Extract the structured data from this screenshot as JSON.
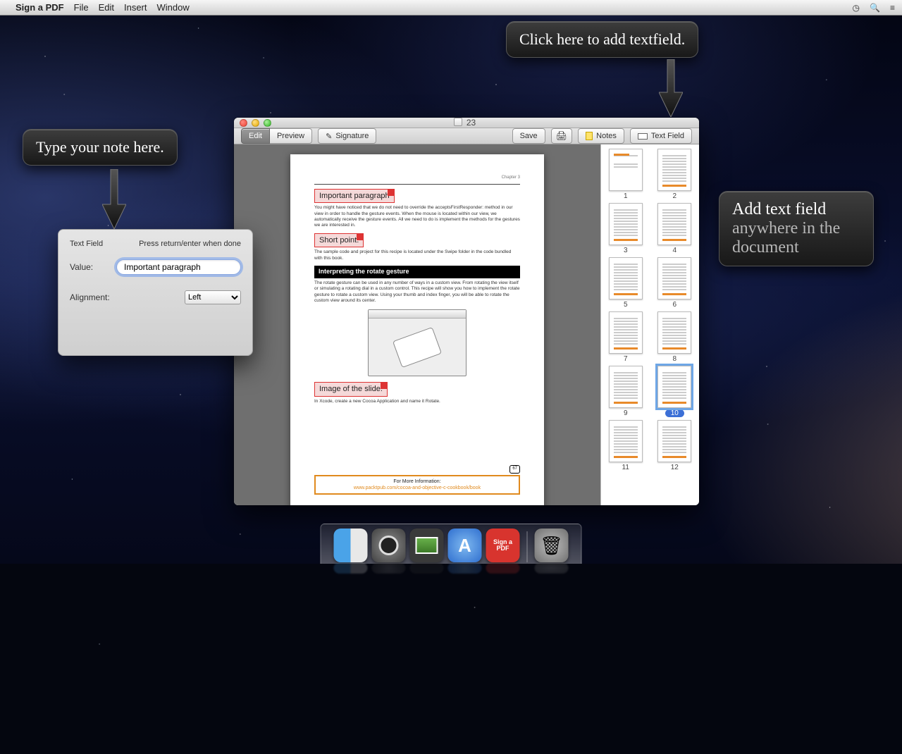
{
  "menubar": {
    "app_name": "Sign a PDF",
    "items": [
      "File",
      "Edit",
      "Insert",
      "Window"
    ]
  },
  "callouts": {
    "type_note": "Type your note here.",
    "click_add": "Click here to add textfield.",
    "anywhere_line1": "Add text field",
    "anywhere_line2": "anywhere in the document"
  },
  "popover": {
    "title": "Text Field",
    "hint": "Press return/enter when done",
    "value_label": "Value:",
    "value": "Important paragraph",
    "align_label": "Alignment:",
    "align_value": "Left"
  },
  "window": {
    "title": "23",
    "toolbar": {
      "edit": "Edit",
      "preview": "Preview",
      "signature": "Signature",
      "save": "Save",
      "notes": "Notes",
      "textfield": "Text Field"
    }
  },
  "page": {
    "chapter": "Chapter 3",
    "annot1": "Important paragraph",
    "body1": "You might have noticed that we do not need to override the acceptsFirstResponder: method in our view in order to handle the gesture events. When the mouse is located within our view, we automatically receive the gesture events. All we need to do is implement the methods for the gestures we are interested in.",
    "annot2": "Short point.",
    "body2": "The sample code and project for this recipe is located under the Swipe folder in the code bundled with this book.",
    "heading": "Interpreting the rotate gesture",
    "body3": "The rotate gesture can be used in any number of ways in a custom view. From rotating the view itself or simulating a rotating dial in a custom control. This recipe will show you how to implement the rotate gesture to rotate a custom view. Using your thumb and index finger, you will be able to rotate the custom view around its center.",
    "annot3": "Image of the slide.",
    "body4": "In Xcode, create a new Cocoa Application and name it Rotate.",
    "pnum": "67",
    "moreinfo": "For More Information:",
    "link": "www.packtpub.com/cocoa-and-objective-c-cookbook/book"
  },
  "thumbnails": {
    "count": 12,
    "selected": 10
  },
  "dock": {
    "signpdf_label": "Sign a PDF"
  }
}
